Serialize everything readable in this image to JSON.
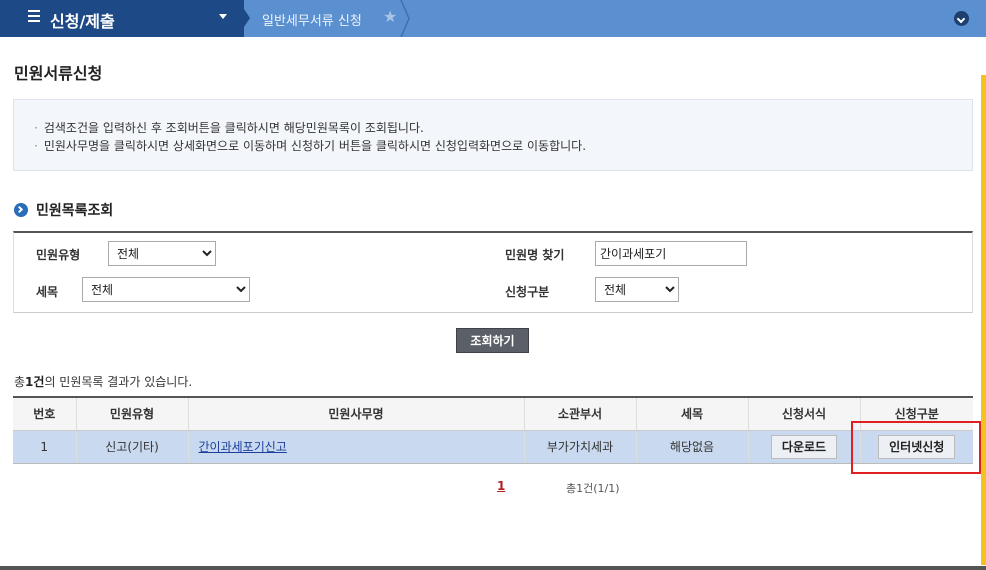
{
  "topbar": {
    "menu_title": "신청/제출",
    "sub_title": "일반세무서류 신청"
  },
  "page": {
    "title": "민원서류신청"
  },
  "info": {
    "line1": "검색조건을 입력하신 후 조회버튼을 클릭하시면 해당민원목록이 조회됩니다.",
    "line2": "민원사무명을 클릭하시면 상세화면으로 이동하며  신청하기 버튼을 클릭하시면 신청입력화면으로 이동합니다."
  },
  "section": {
    "title": "민원목록조회"
  },
  "search": {
    "type_label": "민원유형",
    "type_value": "전체",
    "name_label": "민원명 찾기",
    "name_value": "간이과세포기",
    "tax_label": "세목",
    "tax_value": "전체",
    "apply_label": "신청구분",
    "apply_value": "전체",
    "button": "조회하기"
  },
  "result": {
    "count_prefix": "총",
    "count": "1건",
    "count_suffix": "의 민원목록 결과가 있습니다."
  },
  "table": {
    "headers": [
      "번호",
      "민원유형",
      "민원사무명",
      "소관부서",
      "세목",
      "신청서식",
      "신청구분"
    ],
    "rows": [
      {
        "no": "1",
        "type": "신고(기타)",
        "name": "간이과세포기신고",
        "dept": "부가가치세과",
        "tax": "해당없음",
        "form_button": "다운로드",
        "apply_button": "인터넷신청"
      }
    ]
  },
  "pagination": {
    "current": "1",
    "total": "총1건(1/1)"
  }
}
